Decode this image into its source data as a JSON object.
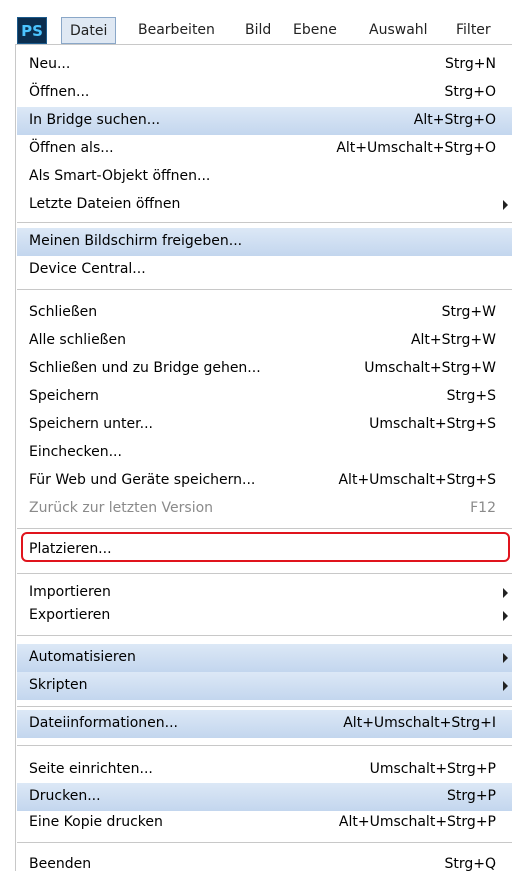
{
  "app_icon": "PS",
  "menubar": {
    "items": [
      "Datei",
      "Bearbeiten",
      "Bild",
      "Ebene",
      "Auswahl",
      "Filter"
    ]
  },
  "menu": {
    "items": [
      {
        "label": "Neu...",
        "shortcut": "Strg+N"
      },
      {
        "label": "Öffnen...",
        "shortcut": "Strg+O"
      },
      {
        "label": "In Bridge suchen...",
        "shortcut": "Alt+Strg+O"
      },
      {
        "label": "Öffnen als...",
        "shortcut": "Alt+Umschalt+Strg+O"
      },
      {
        "label": "Als Smart-Objekt öffnen...",
        "shortcut": ""
      },
      {
        "label": "Letzte Dateien öffnen",
        "shortcut": ""
      },
      {
        "label": "Meinen Bildschirm freigeben...",
        "shortcut": ""
      },
      {
        "label": "Device Central...",
        "shortcut": ""
      },
      {
        "label": "Schließen",
        "shortcut": "Strg+W"
      },
      {
        "label": "Alle schließen",
        "shortcut": "Alt+Strg+W"
      },
      {
        "label": "Schließen und zu Bridge gehen...",
        "shortcut": "Umschalt+Strg+W"
      },
      {
        "label": "Speichern",
        "shortcut": "Strg+S"
      },
      {
        "label": "Speichern unter...",
        "shortcut": "Umschalt+Strg+S"
      },
      {
        "label": "Einchecken...",
        "shortcut": ""
      },
      {
        "label": "Für Web und Geräte speichern...",
        "shortcut": "Alt+Umschalt+Strg+S"
      },
      {
        "label": "Zurück zur letzten Version",
        "shortcut": "F12"
      },
      {
        "label": "Platzieren...",
        "shortcut": ""
      },
      {
        "label": "Importieren",
        "shortcut": ""
      },
      {
        "label": "Exportieren",
        "shortcut": ""
      },
      {
        "label": "Automatisieren",
        "shortcut": ""
      },
      {
        "label": "Skripten",
        "shortcut": ""
      },
      {
        "label": "Dateiinformationen...",
        "shortcut": "Alt+Umschalt+Strg+I"
      },
      {
        "label": "Seite einrichten...",
        "shortcut": "Umschalt+Strg+P"
      },
      {
        "label": "Drucken...",
        "shortcut": "Strg+P"
      },
      {
        "label": "Eine Kopie drucken",
        "shortcut": "Alt+Umschalt+Strg+P"
      },
      {
        "label": "Beenden",
        "shortcut": "Strg+Q"
      }
    ]
  },
  "colors": {
    "highlight_top": "#dce8f6",
    "highlight_bottom": "#c3d6ee",
    "callout": "#e0141d"
  }
}
